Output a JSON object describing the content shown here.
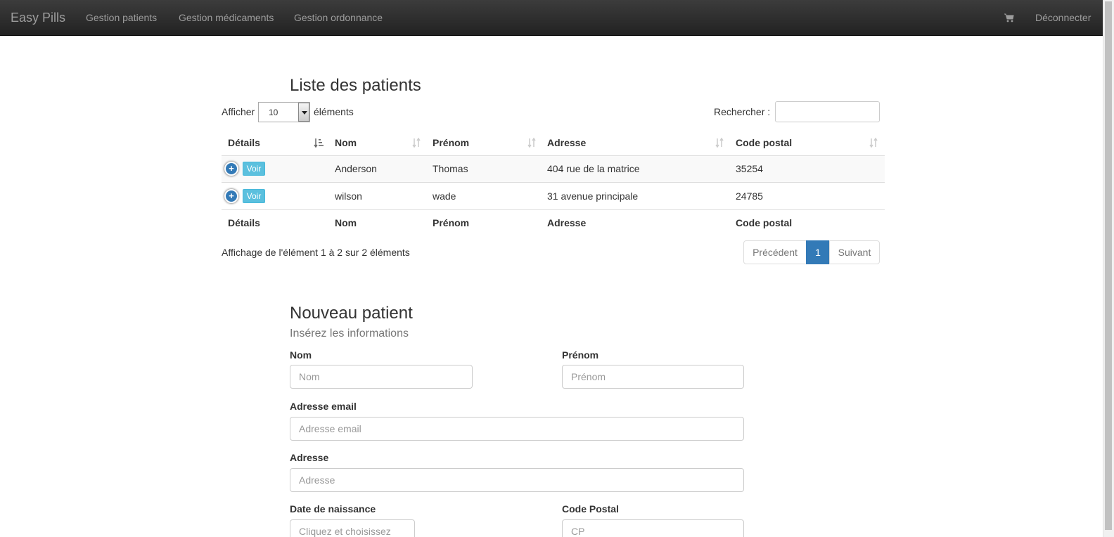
{
  "navbar": {
    "brand": "Easy Pills",
    "links": [
      "Gestion patients",
      "Gestion médicaments",
      "Gestion ordonnance"
    ],
    "logout": "Déconnecter",
    "cart_icon": "shopping-cart-icon"
  },
  "patients_list": {
    "title": "Liste des patients",
    "show_label": "Afficher",
    "page_size": "10",
    "elements_label": "éléments",
    "search_label": "Rechercher :",
    "columns": [
      "Détails",
      "Nom",
      "Prénom",
      "Adresse",
      "Code postal"
    ],
    "rows": [
      {
        "view": "Voir",
        "nom": "Anderson",
        "prenom": "Thomas",
        "adresse": "404 rue de la matrice",
        "code_postal": "35254"
      },
      {
        "view": "Voir",
        "nom": "wilson",
        "prenom": "wade",
        "adresse": "31 avenue principale",
        "code_postal": "24785"
      }
    ],
    "info": "Affichage de l'élément 1 à 2 sur 2 éléments",
    "pagination": {
      "prev": "Précédent",
      "current": "1",
      "next": "Suivant"
    }
  },
  "new_patient": {
    "title": "Nouveau patient",
    "subtitle": "Insérez les informations",
    "fields": {
      "nom": {
        "label": "Nom",
        "placeholder": "Nom"
      },
      "prenom": {
        "label": "Prénom",
        "placeholder": "Prénom"
      },
      "email": {
        "label": "Adresse email",
        "placeholder": "Adresse email"
      },
      "adresse": {
        "label": "Adresse",
        "placeholder": "Adresse"
      },
      "date_naissance": {
        "label": "Date de naissance",
        "placeholder": "Cliquez et choisissez"
      },
      "code_postal": {
        "label": "Code Postal",
        "placeholder": "CP"
      }
    }
  }
}
